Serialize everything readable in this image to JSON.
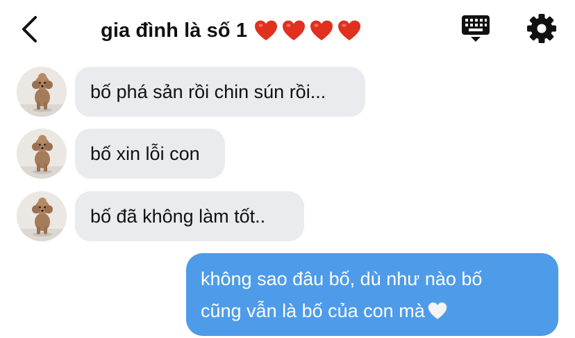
{
  "header": {
    "title": "gia đình là số 1",
    "back_icon": "chevron-left-icon",
    "keyboard_icon": "keyboard-icon",
    "settings_icon": "gear-icon",
    "heart_count": 4,
    "heart_color": "#e0301e"
  },
  "messages": [
    {
      "direction": "incoming",
      "text": "bố phá sản rồi chin sún rồi..."
    },
    {
      "direction": "incoming",
      "text": "bố xin lỗi con"
    },
    {
      "direction": "incoming",
      "text": "bố đã không làm tốt.."
    }
  ],
  "reply": {
    "direction": "outgoing",
    "line1": "không sao đâu bố, dù như nào bố",
    "line2": "cũng vẫn là bố của con mà",
    "trailing_icon": "white-heart-icon"
  },
  "colors": {
    "incoming_bubble": "#e9ebef",
    "outgoing_bubble": "#4e9bea",
    "icon": "#111111"
  }
}
